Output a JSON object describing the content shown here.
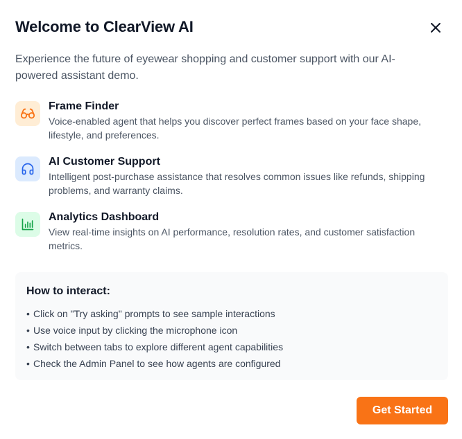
{
  "modal": {
    "title": "Welcome to ClearView AI",
    "close_icon": "close-icon",
    "intro": "Experience the future of eyewear shopping and customer support with our AI-powered assistant demo."
  },
  "features": [
    {
      "icon": "glasses-icon",
      "icon_color": "#f97316",
      "icon_bg": "#ffedd5",
      "title": "Frame Finder",
      "description": "Voice-enabled agent that helps you discover perfect frames based on your face shape, lifestyle, and preferences."
    },
    {
      "icon": "headphones-icon",
      "icon_color": "#2563eb",
      "icon_bg": "#dbeafe",
      "title": "AI Customer Support",
      "description": "Intelligent post-purchase assistance that resolves common issues like refunds, shipping problems, and warranty claims."
    },
    {
      "icon": "bar-chart-icon",
      "icon_color": "#16a34a",
      "icon_bg": "#dcfce7",
      "title": "Analytics Dashboard",
      "description": "View real-time insights on AI performance, resolution rates, and customer satisfaction metrics."
    }
  ],
  "how_to": {
    "title": "How to interact:",
    "items": [
      "Click on \"Try asking\" prompts to see sample interactions",
      "Use voice input by clicking the microphone icon",
      "Switch between tabs to explore different agent capabilities",
      "Check the Admin Panel to see how agents are configured"
    ]
  },
  "footer": {
    "get_started_label": "Get Started",
    "accent_color": "#f97316"
  }
}
